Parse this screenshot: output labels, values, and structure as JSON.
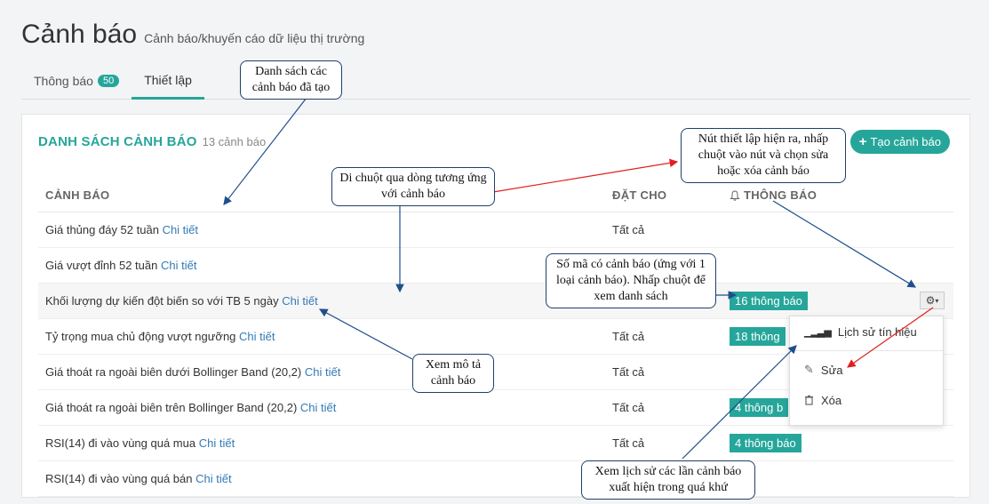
{
  "header": {
    "title": "Cảnh báo",
    "subtitle": "Cảnh báo/khuyến cáo dữ liệu thị trường"
  },
  "tabs": [
    {
      "label": "Thông báo",
      "badge": "50"
    },
    {
      "label": "Thiết lập"
    }
  ],
  "card": {
    "title": "DANH SÁCH CẢNH BÁO",
    "count": "13 cảnh báo",
    "create_button": "Tạo cảnh báo"
  },
  "table": {
    "headers": {
      "name": "CẢNH BÁO",
      "for": "ĐẶT CHO",
      "notif": "THÔNG BÁO"
    },
    "rows": [
      {
        "name": "Giá thủng đáy 52 tuần",
        "link": "Chi tiết",
        "for": "Tất cả",
        "notif": ""
      },
      {
        "name": "Giá vượt đỉnh 52 tuần",
        "link": "Chi tiết",
        "for": "",
        "notif": ""
      },
      {
        "name": "Khối lượng dự kiến đột biến so với TB 5 ngày",
        "link": "Chi tiết",
        "for": "",
        "notif": "16 thông báo"
      },
      {
        "name": "Tỷ trọng mua chủ động vượt ngưỡng",
        "link": "Chi tiết",
        "for": "Tất cả",
        "notif": "18 thông"
      },
      {
        "name": "Giá thoát ra ngoài biên dưới Bollinger Band (20,2)",
        "link": "Chi tiết",
        "for": "Tất cả",
        "notif": ""
      },
      {
        "name": "Giá thoát ra ngoài biên trên Bollinger Band (20,2)",
        "link": "Chi tiết",
        "for": "Tất cả",
        "notif": "4 thông b"
      },
      {
        "name": "RSI(14) đi vào vùng quá mua",
        "link": "Chi tiết",
        "for": "Tất cả",
        "notif": "4 thông báo"
      },
      {
        "name": "RSI(14) đi vào vùng quá bán",
        "link": "Chi tiết",
        "for": "",
        "notif": ""
      }
    ]
  },
  "dropdown": {
    "history": "Lịch sử tín hiệu",
    "edit": "Sửa",
    "delete": "Xóa"
  },
  "callouts": {
    "list": "Danh sách các cảnh báo đã tạo",
    "hover": "Di chuột qua dòng tương ứng với cảnh báo",
    "settings": "Nút thiết lập hiện ra, nhấp chuột vào nút và chọn sửa hoặc xóa cảnh báo",
    "count": "Số mã có cảnh báo (ứng với 1 loại cảnh báo). Nhấp chuột để xem danh sách",
    "detail": "Xem mô tả cảnh báo",
    "history": "Xem lịch sử các lần cảnh báo xuất hiện trong quá khứ"
  },
  "colors": {
    "accent": "#26a69a",
    "link": "#337ab7",
    "callout_border": "#1f3f6b",
    "arrow_red": "#e02020",
    "arrow_blue": "#1f4e8c"
  }
}
